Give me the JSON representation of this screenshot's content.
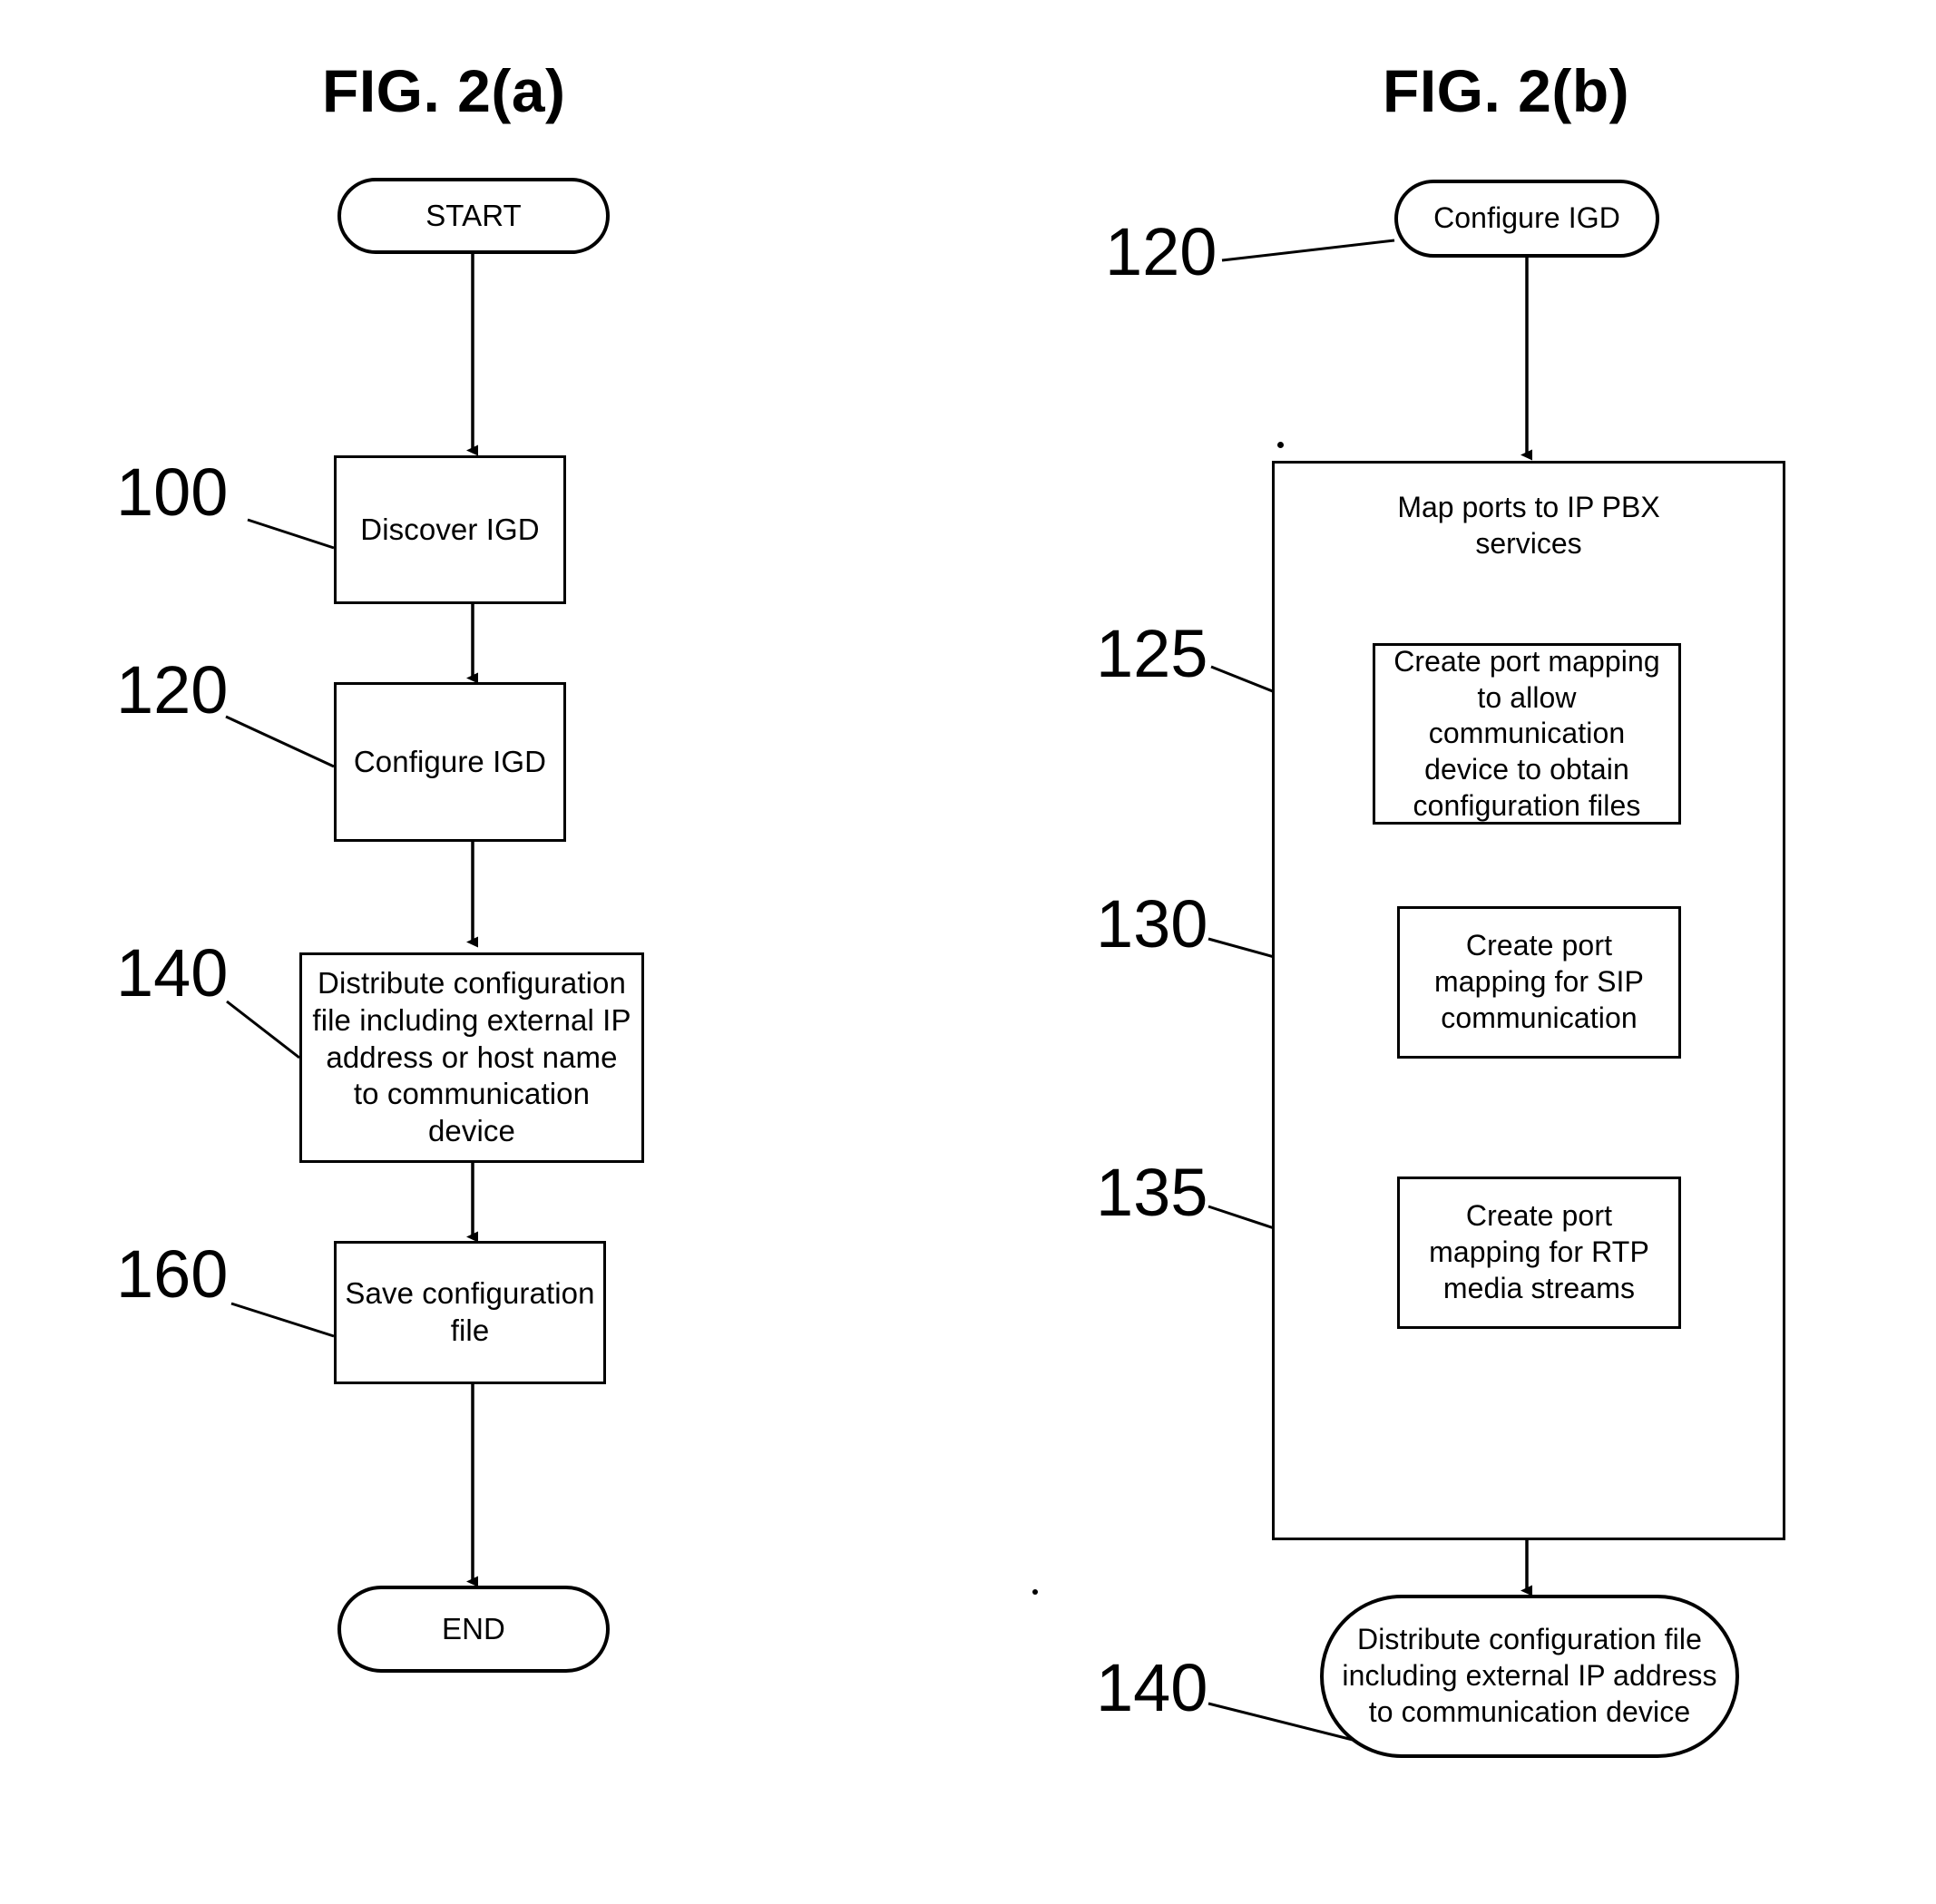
{
  "figures": [
    {
      "id": "fig-2a",
      "title": "FIG. 2(a)",
      "nodes": [
        {
          "key": "start",
          "shape": "oval",
          "text": "START"
        },
        {
          "key": "n100",
          "shape": "rect",
          "text": "Discover IGD"
        },
        {
          "key": "n120",
          "shape": "rect",
          "text": "Configure IGD"
        },
        {
          "key": "n140",
          "shape": "rect",
          "text": "Distribute configuration\nfile including external IP\naddress or host name\nto communication\ndevice"
        },
        {
          "key": "n160",
          "shape": "rect",
          "text": "Save configuration\nfile"
        },
        {
          "key": "end",
          "shape": "oval",
          "text": "END"
        }
      ],
      "ref_numbers": [
        {
          "key": "r100",
          "label": "100"
        },
        {
          "key": "r120",
          "label": "120"
        },
        {
          "key": "r140",
          "label": "140"
        },
        {
          "key": "r160",
          "label": "160"
        }
      ]
    },
    {
      "id": "fig-2b",
      "title": "FIG. 2(b)",
      "nodes": [
        {
          "key": "b120",
          "shape": "oval",
          "text": "Configure IGD"
        },
        {
          "key": "b125",
          "shape": "rect",
          "text": "Create port mapping\nto allow\ncommunication\ndevice to obtain\nconfiguration files"
        },
        {
          "key": "b130",
          "shape": "rect",
          "text": "Create port\nmapping for SIP\ncommunication"
        },
        {
          "key": "b135",
          "shape": "rect",
          "text": "Create port\nmapping for RTP\nmedia streams"
        },
        {
          "key": "b140",
          "shape": "oval",
          "text": "Distribute configuration file\nincluding external IP address\nto communication device"
        }
      ],
      "container": {
        "key": "map-ports-container",
        "title": "Map ports to IP PBX\nservices"
      },
      "ref_numbers": [
        {
          "key": "rb120",
          "label": "120"
        },
        {
          "key": "rb125",
          "label": "125"
        },
        {
          "key": "rb130",
          "label": "130"
        },
        {
          "key": "rb135",
          "label": "135"
        },
        {
          "key": "rb140",
          "label": "140"
        }
      ]
    }
  ],
  "style": {
    "ink": "#000000",
    "paper": "#ffffff"
  }
}
